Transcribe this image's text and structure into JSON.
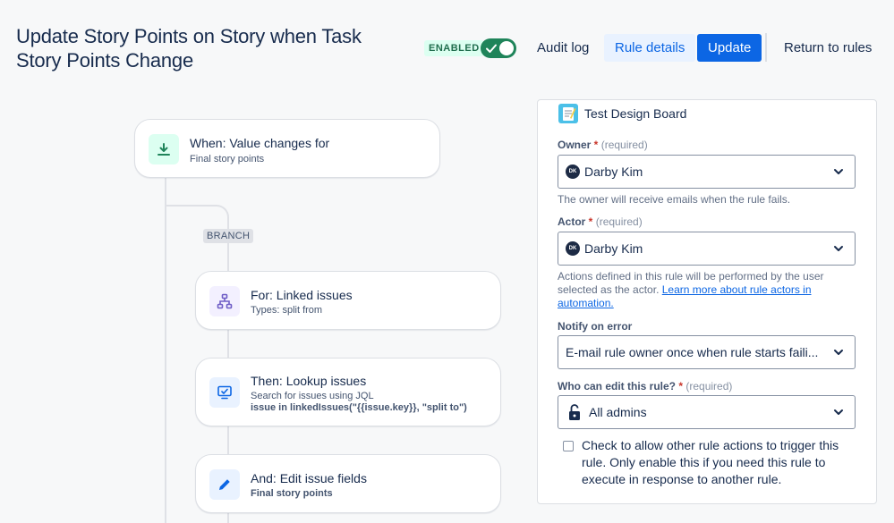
{
  "header": {
    "title": "Update Story Points on Story when Task Story Points Change",
    "enabled_label": "ENABLED",
    "audit_log": "Audit log",
    "rule_details": "Rule details",
    "update": "Update",
    "return_to_rules": "Return to rules"
  },
  "flow": {
    "trigger": {
      "title": "When: Value changes for",
      "subtitle": "Final story points"
    },
    "branch_label": "BRANCH",
    "branch": {
      "title": "For: Linked issues",
      "subtitle": "Types: split from"
    },
    "lookup": {
      "title": "Then: Lookup issues",
      "subtitle": "Search for issues using JQL",
      "jql": "issue in linkedIssues(\"{{issue.key}}, \"split to\")"
    },
    "edit": {
      "title": "And: Edit issue fields",
      "subtitle": "Final story points"
    }
  },
  "details": {
    "project": "Test Design Board",
    "owner": {
      "label": "Owner",
      "required": "(required)",
      "value": "Darby Kim",
      "initials": "DK",
      "helper": "The owner will receive emails when the rule fails."
    },
    "actor": {
      "label": "Actor",
      "required": "(required)",
      "value": "Darby Kim",
      "initials": "DK",
      "helper": "Actions defined in this rule will be performed by the user selected as the actor.",
      "link": "Learn more about rule actors in automation."
    },
    "notify": {
      "label": "Notify on error",
      "value": "E-mail rule owner once when rule starts faili..."
    },
    "edit_access": {
      "label": "Who can edit this rule?",
      "required": "(required)",
      "value": "All admins"
    },
    "allow_trigger": {
      "checked": false,
      "label": "Check to allow other rule actions to trigger this rule. Only enable this if you need this rule to execute in response to another rule."
    }
  },
  "colors": {
    "primary": "#0c66e4",
    "enabled_green": "#1f845a",
    "trigger_icon_bg": "#dcfff1",
    "branch_icon_bg": "#f3f0ff",
    "action_icon_bg": "#e9f2ff"
  }
}
